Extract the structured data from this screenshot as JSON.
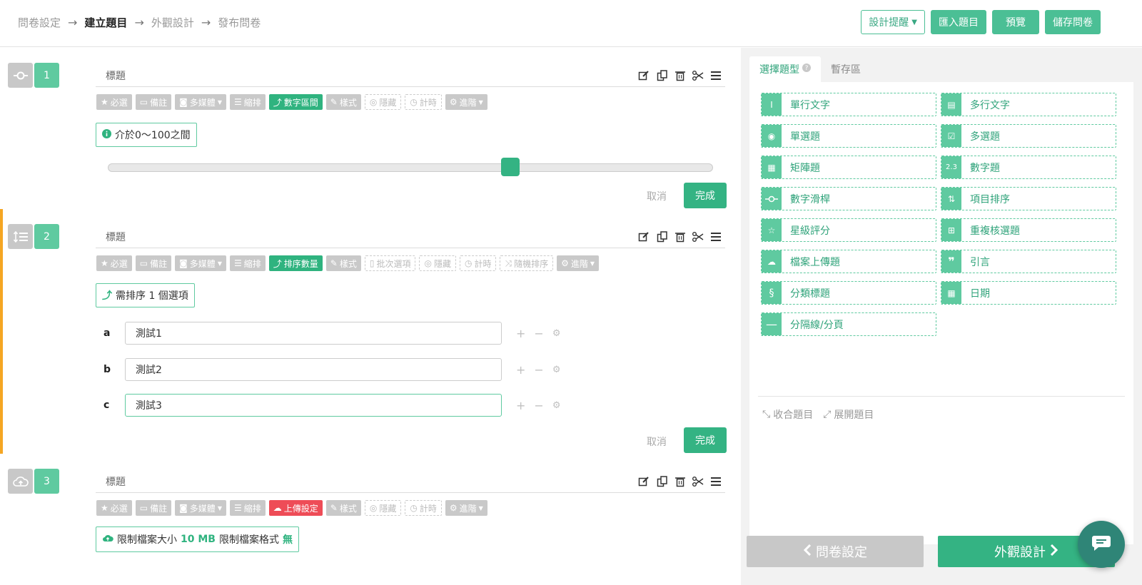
{
  "breadcrumb": [
    "問卷設定",
    "建立題目",
    "外觀設計",
    "發布問卷"
  ],
  "breadcrumb_active": 1,
  "top_actions": {
    "design_tips": "設計提醒",
    "import": "匯入題目",
    "preview": "預覽",
    "save": "儲存問卷"
  },
  "questions": [
    {
      "number": "1",
      "type_icon": "slider-icon",
      "title": "標題",
      "options": [
        {
          "label": "必選",
          "icon": "star-icon",
          "style": "gray"
        },
        {
          "label": "備註",
          "icon": "comment-icon",
          "style": "gray"
        },
        {
          "label": "多媒體",
          "icon": "camera-icon",
          "style": "gray",
          "dropdown": true
        },
        {
          "label": "縮排",
          "icon": "indent-icon",
          "style": "gray"
        },
        {
          "label": "數字區間",
          "icon": "arrow-up-icon",
          "style": "green"
        },
        {
          "label": "樣式",
          "icon": "brush-icon",
          "style": "gray"
        },
        {
          "label": "隱藏",
          "icon": "eye-slash-icon",
          "style": "dashed"
        },
        {
          "label": "計時",
          "icon": "clock-icon",
          "style": "dashed"
        },
        {
          "label": "進階",
          "icon": "gear-icon",
          "style": "gray",
          "dropdown": true
        }
      ],
      "hint": "介於0～100之間",
      "slider_value": 67,
      "cancel": "取消",
      "done": "完成"
    },
    {
      "number": "2",
      "type_icon": "sort-list-icon",
      "title": "標題",
      "options": [
        {
          "label": "必選",
          "icon": "star-icon",
          "style": "gray"
        },
        {
          "label": "備註",
          "icon": "comment-icon",
          "style": "gray"
        },
        {
          "label": "多媒體",
          "icon": "camera-icon",
          "style": "gray",
          "dropdown": true
        },
        {
          "label": "縮排",
          "icon": "indent-icon",
          "style": "gray"
        },
        {
          "label": "排序數量",
          "icon": "arrow-up-icon",
          "style": "green"
        },
        {
          "label": "樣式",
          "icon": "brush-icon",
          "style": "gray"
        },
        {
          "label": "批次選項",
          "icon": "file-icon",
          "style": "dashed"
        },
        {
          "label": "隱藏",
          "icon": "eye-slash-icon",
          "style": "dashed"
        },
        {
          "label": "計時",
          "icon": "clock-icon",
          "style": "dashed"
        },
        {
          "label": "隨機排序",
          "icon": "shuffle-icon",
          "style": "dashed"
        },
        {
          "label": "進階",
          "icon": "gear-icon",
          "style": "gray",
          "dropdown": true
        }
      ],
      "hint": "需排序 1 個選項",
      "items": [
        {
          "letter": "a",
          "value": "測試1"
        },
        {
          "letter": "b",
          "value": "測試2"
        },
        {
          "letter": "c",
          "value": "測試3"
        }
      ],
      "cancel": "取消",
      "done": "完成"
    },
    {
      "number": "3",
      "type_icon": "cloud-upload-icon",
      "title": "標題",
      "options": [
        {
          "label": "必選",
          "icon": "star-icon",
          "style": "gray"
        },
        {
          "label": "備註",
          "icon": "comment-icon",
          "style": "gray"
        },
        {
          "label": "多媒體",
          "icon": "camera-icon",
          "style": "gray",
          "dropdown": true
        },
        {
          "label": "縮排",
          "icon": "indent-icon",
          "style": "gray"
        },
        {
          "label": "上傳設定",
          "icon": "cloud-upload-icon",
          "style": "red"
        },
        {
          "label": "樣式",
          "icon": "brush-icon",
          "style": "gray"
        },
        {
          "label": "隱藏",
          "icon": "eye-slash-icon",
          "style": "dashed"
        },
        {
          "label": "計時",
          "icon": "clock-icon",
          "style": "dashed"
        },
        {
          "label": "進階",
          "icon": "gear-icon",
          "style": "gray",
          "dropdown": true
        }
      ],
      "hint_parts": {
        "size_label": "限制檔案大小",
        "size_value": "10 MB",
        "format_label": "限制檔案格式",
        "format_value": "無"
      }
    }
  ],
  "right_panel": {
    "tabs": [
      "選擇題型",
      "暫存區"
    ],
    "question_types": [
      {
        "label": "單行文字",
        "icon": "single-line-text-icon"
      },
      {
        "label": "多行文字",
        "icon": "multi-line-text-icon"
      },
      {
        "label": "單選題",
        "icon": "radio-icon"
      },
      {
        "label": "多選題",
        "icon": "checkbox-icon"
      },
      {
        "label": "矩陣題",
        "icon": "matrix-icon"
      },
      {
        "label": "數字題",
        "icon": "number-icon"
      },
      {
        "label": "數字滑桿",
        "icon": "slider-icon"
      },
      {
        "label": "項目排序",
        "icon": "sort-list-icon"
      },
      {
        "label": "星級評分",
        "icon": "star-outline-icon"
      },
      {
        "label": "重複核選題",
        "icon": "repeat-check-icon"
      },
      {
        "label": "檔案上傳題",
        "icon": "cloud-upload-icon"
      },
      {
        "label": "引言",
        "icon": "quote-icon"
      },
      {
        "label": "分類標題",
        "icon": "section-icon"
      },
      {
        "label": "日期",
        "icon": "calendar-icon"
      },
      {
        "label": "分隔線/分頁",
        "icon": "minus-icon"
      }
    ],
    "collapse_all": "收合題目",
    "expand_all": "展開題目"
  },
  "bottom_nav": {
    "prev": "問卷設定",
    "next": "外觀設計"
  },
  "colors": {
    "brand": "#4bbf95",
    "brand_dark": "#34b383",
    "accent_orange": "#f5a623",
    "danger": "#ee4c57"
  }
}
